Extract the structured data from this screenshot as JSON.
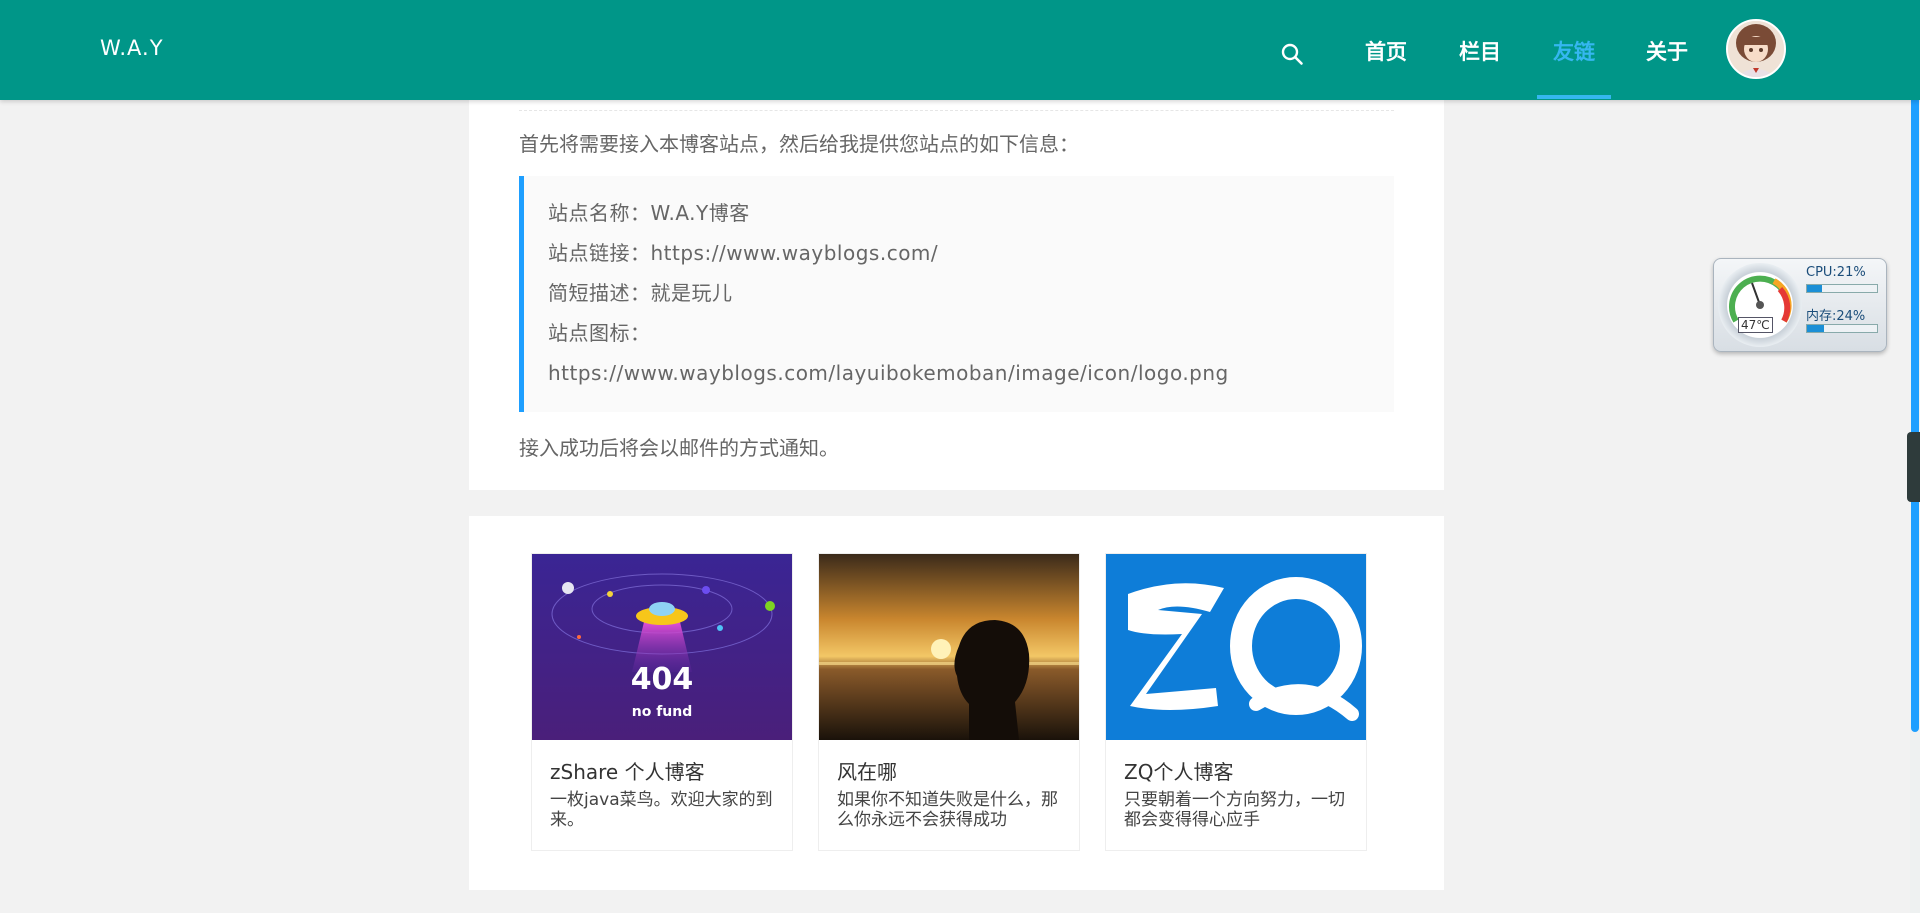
{
  "header": {
    "brand": "W.A.Y",
    "nav": [
      "首页",
      "栏目",
      "友链",
      "关于"
    ],
    "active_nav": "友链"
  },
  "apply": {
    "intro": "首先将需要接入本博客站点，然后给我提供您站点的如下信息：",
    "lines": [
      "站点名称：W.A.Y博客",
      "站点链接：https://www.wayblogs.com/",
      "简短描述：就是玩儿",
      "站点图标：",
      "https://www.wayblogs.com/layuibokemoban/image/icon/logo.png"
    ],
    "outro": "接入成功后将会以邮件的方式通知。"
  },
  "links": [
    {
      "title": "zShare 个人博客",
      "desc": "一枚java菜鸟。欢迎大家的到来。",
      "thumb_text": [
        "404",
        "no fund"
      ],
      "thumb_icon": "ufo-404-image"
    },
    {
      "title": "风在哪",
      "desc": "如果你不知道失败是什么，那么你永远不会获得成功",
      "thumb_icon": "sunset-silhouette-image"
    },
    {
      "title": "ZQ个人博客",
      "desc": "只要朝着一个方向努力，一切都会变得得心应手",
      "thumb_text": [
        "ZQ"
      ],
      "thumb_icon": "zq-logo-image"
    }
  ],
  "widget": {
    "cpu_label": "CPU:21%",
    "mem_label": "内存:24%",
    "temp_label": "47℃",
    "cpu_level": 0.21,
    "mem_level": 0.24
  },
  "colors": {
    "header_bg": "#009688",
    "active_nav": "#35b7f0",
    "quote_border": "#1e9fff"
  }
}
